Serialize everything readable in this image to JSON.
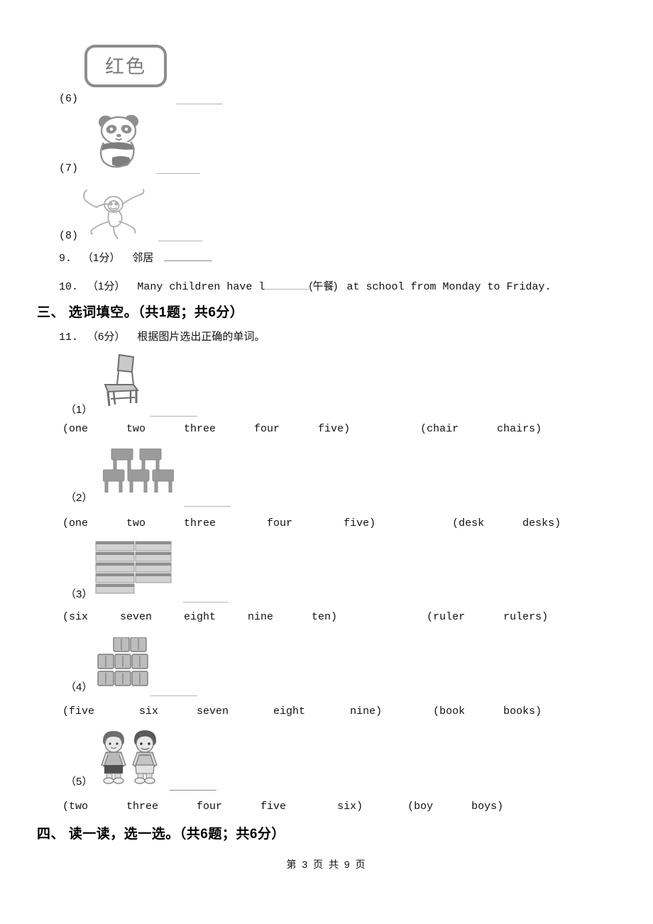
{
  "page": {
    "footer": "第 3 页 共 9 页",
    "page_number": 3,
    "total_pages": 9
  },
  "picture_fill_items": [
    {
      "num": "(6)",
      "image": "red-color-label",
      "image_text": "红色",
      "blank": ""
    },
    {
      "num": "(7)",
      "image": "panda",
      "blank": ""
    },
    {
      "num": "(8)",
      "image": "monkey",
      "blank": ""
    }
  ],
  "questions": [
    {
      "number": "9.",
      "marks": "（1分）",
      "text": "邻居",
      "blank": "",
      "is_cjk": true
    },
    {
      "number": "10.",
      "marks": "（1分）",
      "text_before": "Many children have l",
      "hint": "(午餐)",
      "text_after": "at school from Monday to Friday.",
      "blank": "",
      "is_cjk": false
    }
  ],
  "section_three": {
    "heading": "三、 选词填空。（共1题；共6分）",
    "question_number": "11.",
    "question_marks": "（6分）",
    "question_prompt": "根据图片选出正确的单词。",
    "items": [
      {
        "num": "（1）",
        "image": "chair-single",
        "image_count": 1,
        "blank": "",
        "number_options": [
          "one",
          "two",
          "three",
          "four",
          "five)"
        ],
        "number_options_open": "(one",
        "word_options_open": "(chair",
        "word_options": [
          "chair",
          "chairs)"
        ]
      },
      {
        "num": "（2）",
        "image": "desks-five",
        "image_count": 5,
        "blank": "",
        "number_options": [
          "one",
          "two",
          "three",
          "four",
          "five)"
        ],
        "word_options": [
          "desk",
          "desks)"
        ]
      },
      {
        "num": "（3）",
        "image": "rulers-nine",
        "image_count": 9,
        "blank": "",
        "number_options": [
          "six",
          "seven",
          "eight",
          "nine",
          "ten)"
        ],
        "word_options": [
          "ruler",
          "rulers)"
        ]
      },
      {
        "num": "（4）",
        "image": "books-eight",
        "image_count": 8,
        "blank": "",
        "number_options": [
          "five",
          "six",
          "seven",
          "eight",
          "nine)"
        ],
        "word_options": [
          "book",
          "books)"
        ]
      },
      {
        "num": "（5）",
        "image": "boys-two",
        "image_count": 2,
        "blank": "",
        "number_options": [
          "two",
          "three",
          "four",
          "five",
          "six)"
        ],
        "word_options": [
          "boy",
          "boys)"
        ]
      }
    ],
    "choice_rows": [
      "(one      two      three      four      five)           (chair      chairs)",
      "(one      two      three        four        five)            (desk      desks)",
      "(six     seven     eight     nine      ten)              (ruler      rulers)",
      "(five       six      seven       eight       nine)        (book      books)",
      "(two      three      four      five        six)       (boy      boys)"
    ]
  },
  "section_four": {
    "heading": "四、 读一读，选一选。（共6题；共6分）"
  },
  "colors": {
    "text": "#111111",
    "rule": "#8a8a8a",
    "faint_rule": "#b5b5b5",
    "art_gray": "#8c8c8c",
    "art_dark": "#5a5a5a"
  }
}
